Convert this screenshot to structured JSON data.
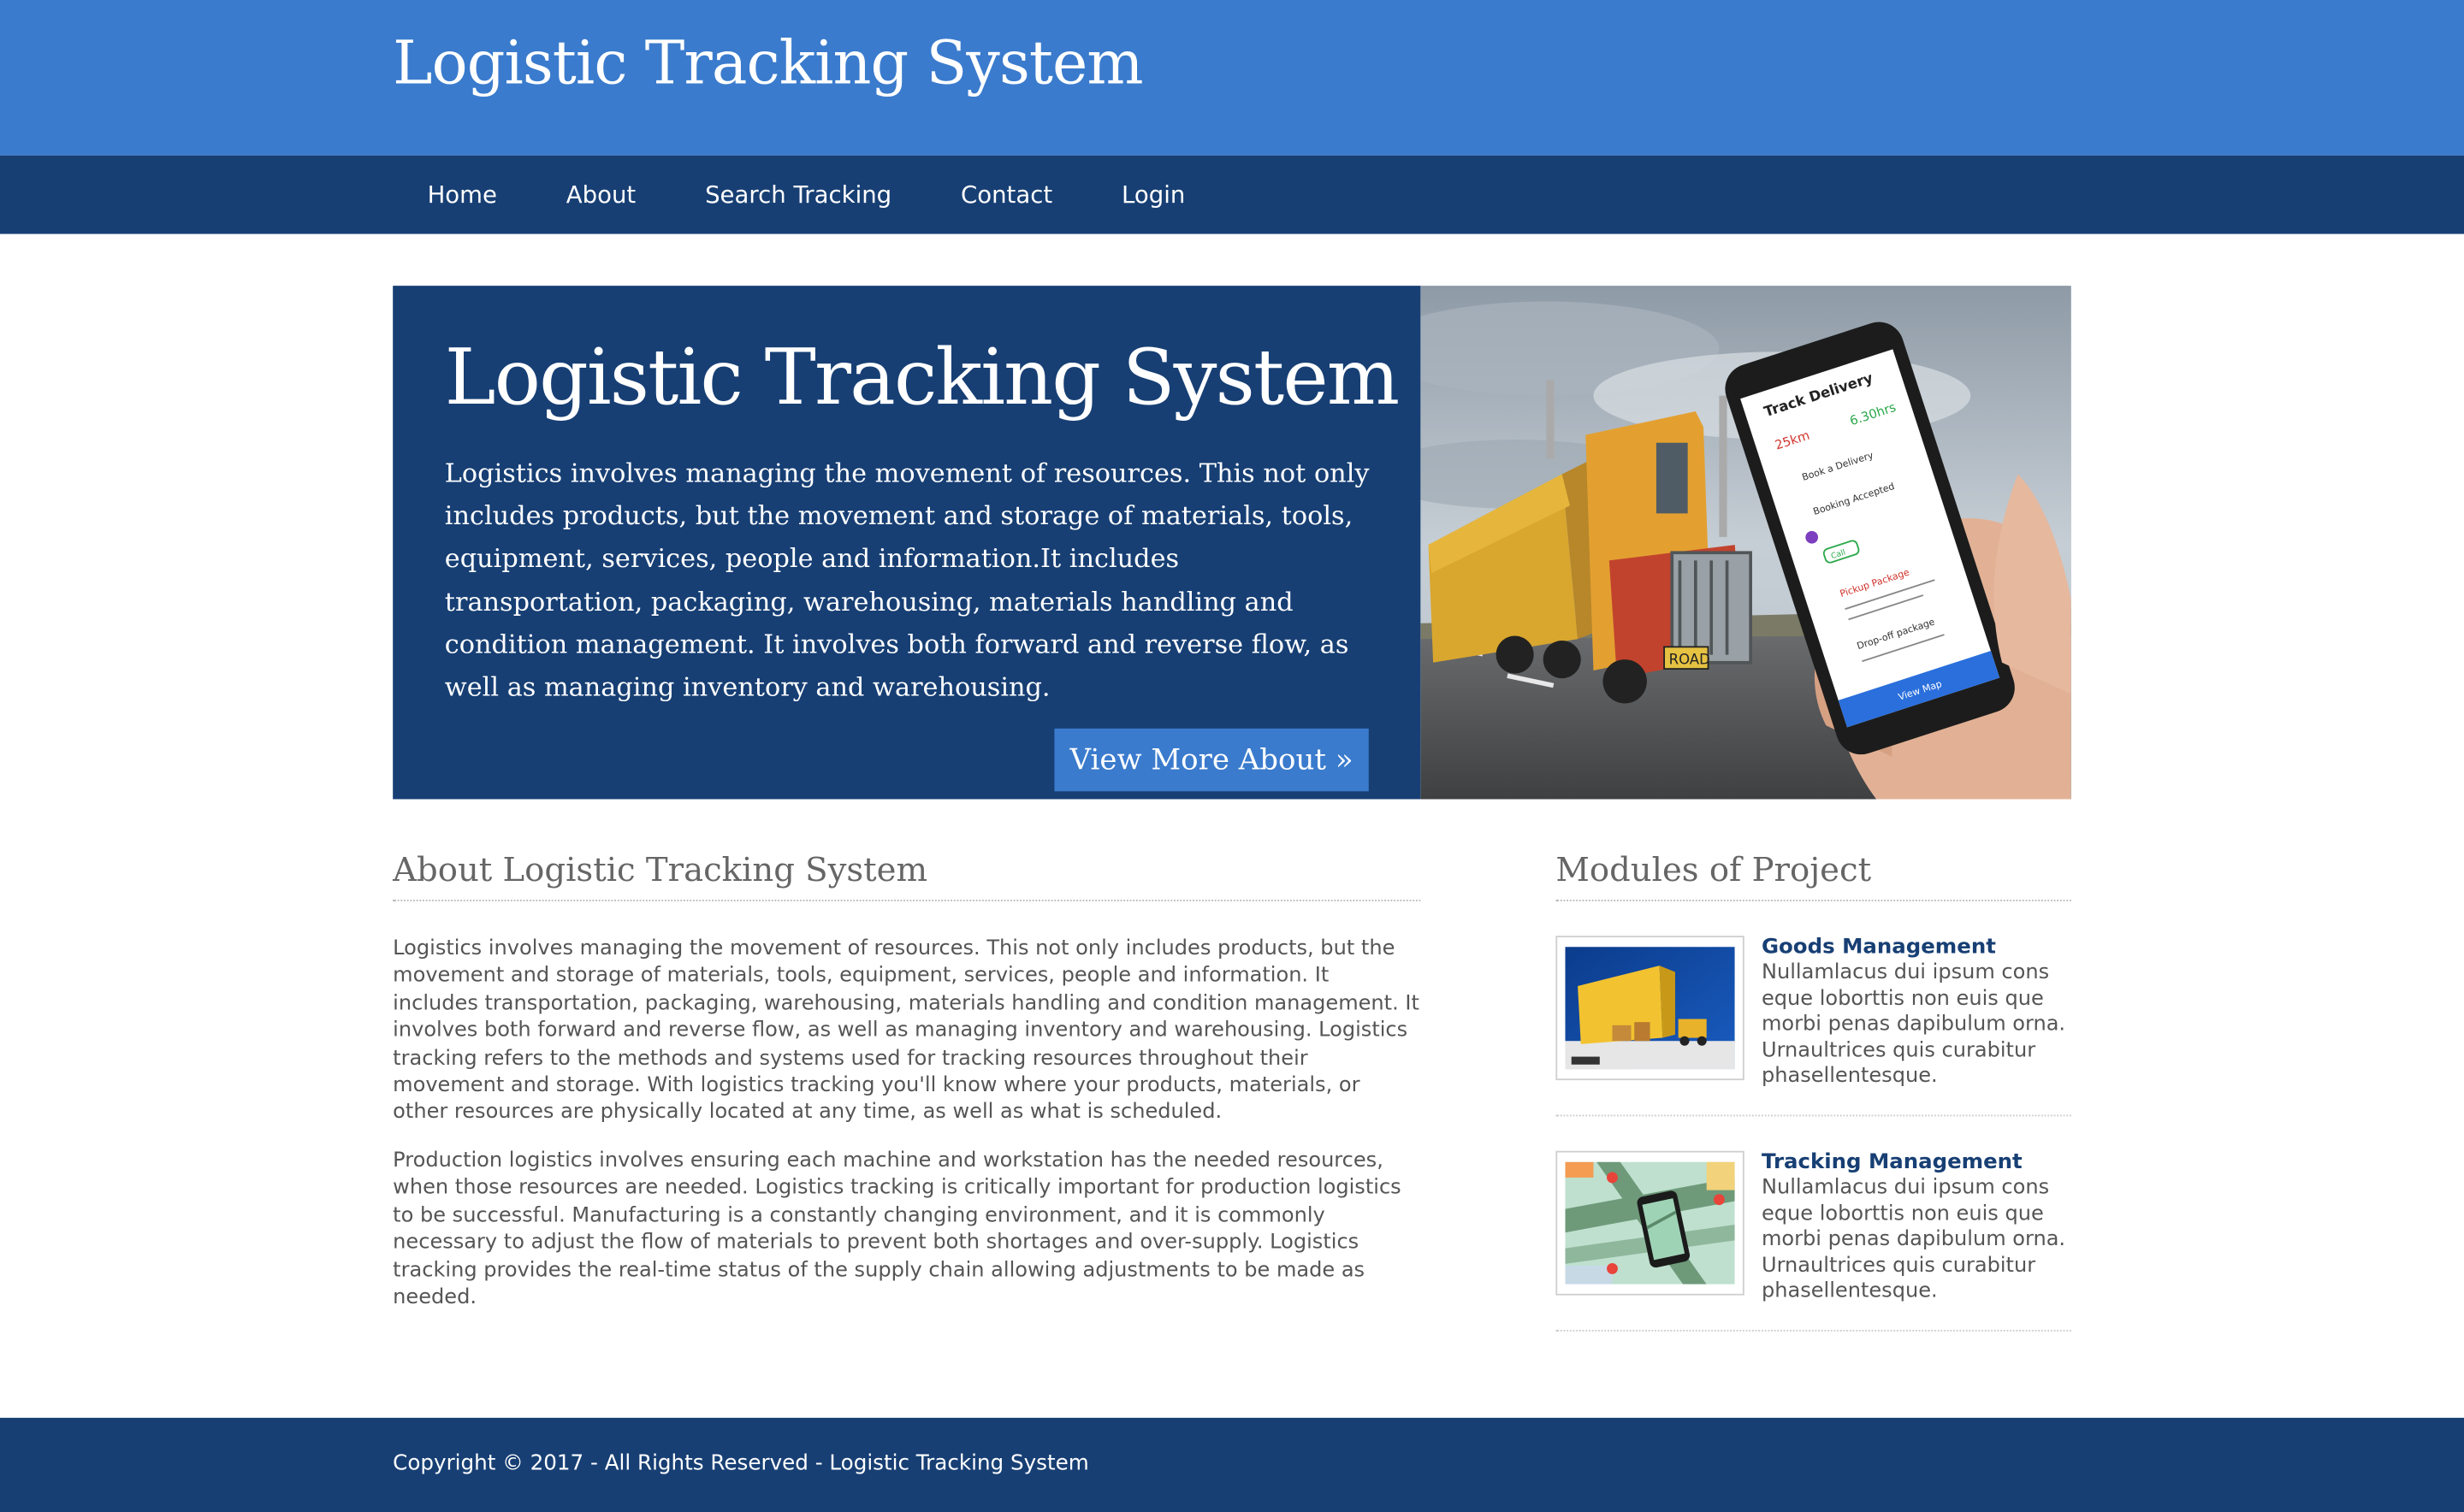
{
  "header": {
    "site_title": "Logistic Tracking System"
  },
  "nav": {
    "items": [
      {
        "label": "Home"
      },
      {
        "label": "About"
      },
      {
        "label": "Search Tracking"
      },
      {
        "label": "Contact"
      },
      {
        "label": "Login"
      }
    ]
  },
  "hero": {
    "title": "Logistic Tracking System",
    "description": "Logistics involves managing the movement of resources. This not only includes products, but the movement and storage of materials, tools, equipment, services, people and information.It includes transportation, packaging, warehousing, materials handling and condition management. It involves both forward and reverse flow, as well as managing inventory and warehousing.",
    "button_label": "View More About »",
    "phone_screen": {
      "title": "Track Delivery",
      "distance": "25km",
      "time": "6.30hrs",
      "step1": "Book a Delivery",
      "step2": "Booking Accepted",
      "call": "Call",
      "pickup": "Pickup Package",
      "dropoff": "Drop-off package",
      "map_button": "View Map"
    },
    "truck_plate": "ROAD"
  },
  "about": {
    "heading": "About Logistic Tracking System",
    "paragraph1": "Logistics involves managing the movement of resources. This not only includes products, but the movement and storage of materials, tools, equipment, services, people and information. It includes transportation, packaging, warehousing, materials handling and condition management. It involves both forward and reverse flow, as well as managing inventory and warehousing. Logistics tracking refers to the methods and systems used for tracking resources throughout their movement and storage. With logistics tracking you'll know where your products, materials, or other resources are physically located at any time, as well as what is scheduled.",
    "paragraph2": "Production logistics involves ensuring each machine and workstation has the needed resources, when those resources are needed. Logistics tracking is critically important for production logistics to be successful. Manufacturing is a constantly changing environment, and it is commonly necessary to adjust the flow of materials to prevent both shortages and over-supply. Logistics tracking provides the real-time status of the supply chain allowing adjustments to be made as needed."
  },
  "modules": {
    "heading": "Modules of Project",
    "items": [
      {
        "title": "Goods Management",
        "description": "Nullamlacus dui ipsum cons eque loborttis non euis que morbi penas dapibulum orna. Urnaultrices quis curabitur phasellentesque."
      },
      {
        "title": "Tracking Management",
        "description": "Nullamlacus dui ipsum cons eque loborttis non euis que morbi penas dapibulum orna. Urnaultrices quis curabitur phasellentesque."
      }
    ]
  },
  "footer": {
    "copyright": "Copyright © 2017 - All Rights Reserved - Logistic Tracking System"
  },
  "colors": {
    "header_blue": "#3a7bcd",
    "nav_navy": "#173f74",
    "footer_navy": "#173f74",
    "module_title": "#173f74"
  }
}
